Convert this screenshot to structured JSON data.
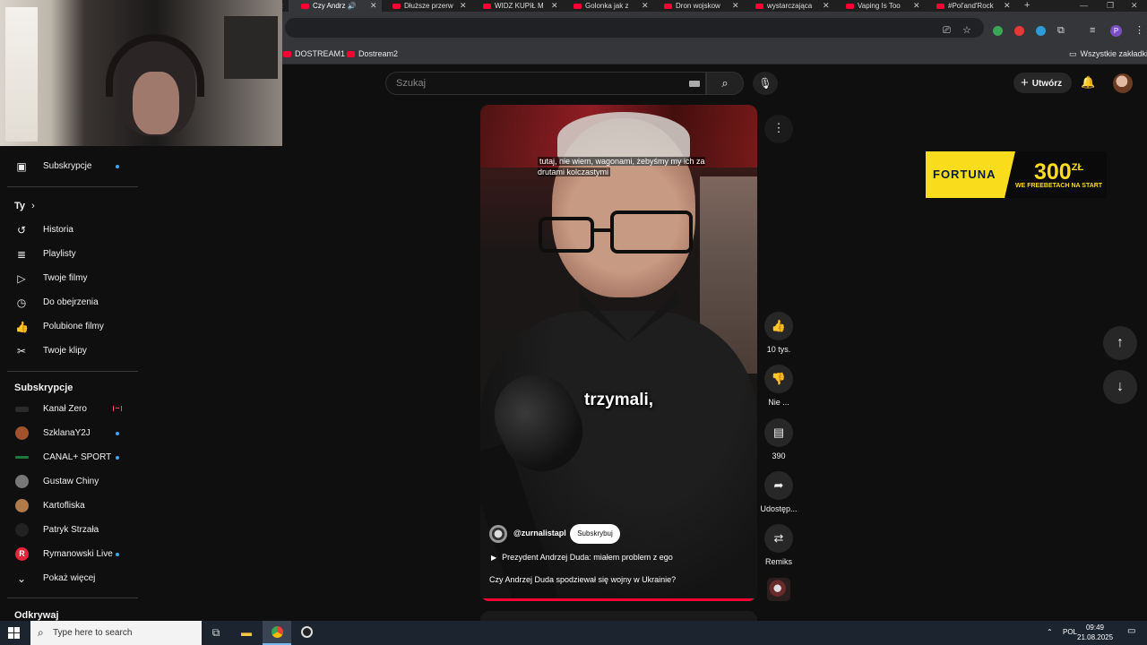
{
  "browser": {
    "tabs": [
      {
        "label": "Czy Andrz",
        "active": true
      },
      {
        "label": "Dłuższe przerw",
        "active": false
      },
      {
        "label": "WIDZ KUPIŁ M",
        "active": false
      },
      {
        "label": "Golonka jak z",
        "active": false
      },
      {
        "label": "Dron wojskow",
        "active": false
      },
      {
        "label": "wystarczająca",
        "active": false
      },
      {
        "label": "Vaping Is Too",
        "active": false
      },
      {
        "label": "#Pol'and'Rock",
        "active": false
      }
    ],
    "profile_initial": "P",
    "bookmarks": [
      "DOSTREAM1",
      "Dostream2"
    ],
    "all_bookmarks": "Wszystkie zakładki"
  },
  "header": {
    "search_placeholder": "Szukaj",
    "create_label": "Utwórz"
  },
  "sidebar": {
    "subscriptions_item": "Subskrypcje",
    "you_heading": "Ty",
    "you_items": [
      {
        "label": "Historia",
        "icon": "history-icon"
      },
      {
        "label": "Playlisty",
        "icon": "playlist-icon"
      },
      {
        "label": "Twoje filmy",
        "icon": "your-videos-icon"
      },
      {
        "label": "Do obejrzenia",
        "icon": "watch-later-icon"
      },
      {
        "label": "Polubione filmy",
        "icon": "liked-icon"
      },
      {
        "label": "Twoje klipy",
        "icon": "clips-icon"
      }
    ],
    "subs_heading": "Subskrypcje",
    "channels": [
      {
        "name": "Kanał Zero",
        "indicator": "live",
        "color": "#2b2b2b"
      },
      {
        "name": "SzklanaY2J",
        "indicator": "dot",
        "color": "#a0522d"
      },
      {
        "name": "CANAL+ SPORT",
        "indicator": "dot",
        "color": "#1e7a3c"
      },
      {
        "name": "Gustaw Chiny",
        "indicator": "none",
        "color": "#777777"
      },
      {
        "name": "Kartofliska",
        "indicator": "none",
        "color": "#b07a4a"
      },
      {
        "name": "Patryk Strzała",
        "indicator": "none",
        "color": "#222222"
      },
      {
        "name": "Rymanowski Live",
        "indicator": "dot",
        "color": "#e5243b"
      }
    ],
    "show_more": "Pokaż więcej",
    "explore_heading": "Odkrywaj"
  },
  "short": {
    "caption_top": "tutaj, nie wiem, wagonami, żebyśmy my ich za drutami kolczastymi",
    "caption_main": "trzymali,",
    "channel": "@zurnalistapl",
    "subscribe": "Subskrybuj",
    "audio": "Prezydent Andrzej Duda: miałem problem z ego",
    "title": "Czy Andrzej Duda spodziewał się wojny w Ukrainie?",
    "progress": 0.98
  },
  "actions": {
    "likes": "10 tys.",
    "dislike": "Nie ...",
    "comments": "390",
    "share": "Udostęp...",
    "remix": "Remiks"
  },
  "ad": {
    "brand": "FORTUNA",
    "amount": "300",
    "currency": "ZŁ",
    "tagline": "WE FREEBETACH NA START",
    "brand_color": "#f9dc1c"
  },
  "taskbar": {
    "search_placeholder": "Type here to search",
    "language": "POL",
    "time": "09:49",
    "date": "21.08.2025"
  }
}
